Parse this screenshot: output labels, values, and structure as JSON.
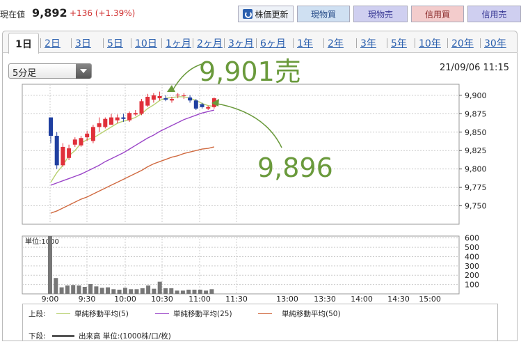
{
  "header": {
    "price_label": "現在値",
    "price": "9,892",
    "change": "+136 (+1.39%)"
  },
  "buttons": {
    "refresh": "株価更新",
    "a": "現物買",
    "b": "現物売",
    "c": "信用買",
    "d": "信用売"
  },
  "tabs": [
    "1日",
    "2日",
    "3日",
    "5日",
    "10日",
    "1ヶ月",
    "2ヶ月",
    "3ヶ月",
    "6ヶ月",
    "1年",
    "2年",
    "3年",
    "5年",
    "10年",
    "20年",
    "30年"
  ],
  "active_tab": "1日",
  "interval": "5分足",
  "timestamp": "21/09/06 11:15",
  "annotations": {
    "high": "9,901売",
    "last": "9,896"
  },
  "chart_data": [
    {
      "type": "candlestick",
      "y_ticks": [
        "9,900",
        "9,875",
        "9,850",
        "9,825",
        "9,800",
        "9,775",
        "9,750"
      ],
      "ylim": [
        9725,
        9915
      ],
      "x_ticks": [
        "9:00",
        "9:30",
        "10:00",
        "10:30",
        "11:00",
        "11:30",
        "13:00",
        "13:30",
        "14:00",
        "14:30",
        "15:00"
      ],
      "candles": [
        [
          9870,
          9870,
          9835,
          9845
        ],
        [
          9845,
          9850,
          9800,
          9805
        ],
        [
          9805,
          9835,
          9803,
          9830
        ],
        [
          9815,
          9833,
          9812,
          9828
        ],
        [
          9833,
          9843,
          9830,
          9840
        ],
        [
          9832,
          9845,
          9830,
          9842
        ],
        [
          9843,
          9852,
          9838,
          9848
        ],
        [
          9838,
          9860,
          9835,
          9857
        ],
        [
          9857,
          9870,
          9850,
          9862
        ],
        [
          9857,
          9870,
          9855,
          9868
        ],
        [
          9860,
          9875,
          9860,
          9870
        ],
        [
          9866,
          9874,
          9862,
          9870
        ],
        [
          9870,
          9875,
          9864,
          9868
        ],
        [
          9866,
          9878,
          9864,
          9876
        ],
        [
          9874,
          9880,
          9872,
          9876
        ],
        [
          9875,
          9895,
          9873,
          9892
        ],
        [
          9886,
          9902,
          9884,
          9898
        ],
        [
          9894,
          9903,
          9890,
          9900
        ],
        [
          9896,
          9905,
          9893,
          9899
        ],
        [
          9896,
          9900,
          9892,
          9894
        ],
        [
          9893,
          9898,
          9890,
          9895
        ],
        [
          9900,
          9903,
          9896,
          9901
        ],
        [
          9899,
          9903,
          9895,
          9900
        ],
        [
          9897,
          9900,
          9890,
          9893
        ],
        [
          9893,
          9895,
          9880,
          9882
        ],
        [
          9888,
          9890,
          9882,
          9884
        ],
        [
          9882,
          9886,
          9880,
          9884
        ],
        [
          9884,
          9897,
          9882,
          9896
        ]
      ],
      "ma5": [
        9782,
        9795,
        9805,
        9818,
        9825,
        9835,
        9840,
        9842,
        9847,
        9852,
        9857,
        9862,
        9865,
        9867,
        9870,
        9875,
        9882,
        9887,
        9893,
        9896,
        9897,
        9898,
        9898,
        9896,
        9893,
        9889,
        9886,
        9885
      ],
      "ma25": [
        9778,
        9781,
        9784,
        9787,
        9790,
        9793,
        9797,
        9801,
        9805,
        9810,
        9814,
        9818,
        9822,
        9827,
        9832,
        9837,
        9842,
        9846,
        9851,
        9855,
        9859,
        9863,
        9867,
        9870,
        9873,
        9876,
        9878,
        9880
      ],
      "ma50": [
        9740,
        9743,
        9747,
        9751,
        9755,
        9759,
        9762,
        9766,
        9770,
        9774,
        9778,
        9782,
        9786,
        9790,
        9794,
        9798,
        9803,
        9807,
        9810,
        9813,
        9816,
        9818,
        9821,
        9823,
        9825,
        9827,
        9828,
        9830
      ]
    },
    {
      "type": "bar",
      "title": "単位:1000",
      "y_ticks": [
        "600",
        "500",
        "400",
        "300",
        "200",
        "100"
      ],
      "ylim": [
        0,
        620
      ],
      "values": [
        620,
        170,
        70,
        90,
        95,
        90,
        75,
        105,
        80,
        65,
        70,
        50,
        45,
        65,
        50,
        50,
        60,
        90,
        55,
        130,
        60,
        60,
        35,
        35,
        45,
        45,
        45,
        35,
        50
      ]
    }
  ],
  "legend": {
    "upper_label": "上段:",
    "lower_label": "下段:",
    "ma5": "単純移動平均(5)",
    "ma25": "単純移動平均(25)",
    "ma50": "単純移動平均(50)",
    "volume": "出来高 単位:(1000株/口/枚)"
  },
  "colors": {
    "up": "#e0303a",
    "down": "#1f3fa0",
    "ma5": "#b8d070",
    "ma25": "#9b46c8",
    "ma50": "#d06a40",
    "annotation": "#6a9a3c"
  }
}
